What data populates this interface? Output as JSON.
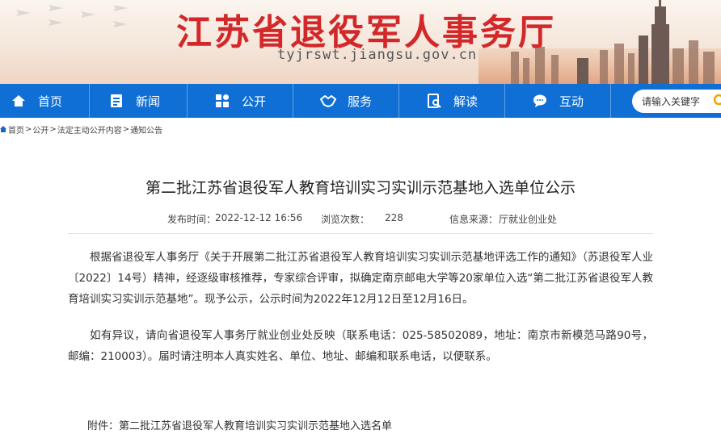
{
  "header": {
    "site_title": "江苏省退役军人事务厅",
    "site_url": "tyjrswt.jiangsu.gov.cn"
  },
  "nav": {
    "items": [
      {
        "label": "首页",
        "icon": "home-icon"
      },
      {
        "label": "新闻",
        "icon": "news-icon"
      },
      {
        "label": "公开",
        "icon": "disclosure-icon"
      },
      {
        "label": "服务",
        "icon": "handshake-icon"
      },
      {
        "label": "解读",
        "icon": "interpretation-icon"
      },
      {
        "label": "互动",
        "icon": "chat-icon"
      }
    ],
    "search_placeholder": "请输入关键字"
  },
  "breadcrumb": {
    "items": [
      "首页",
      "公开",
      "法定主动公开内容",
      "通知公告"
    ],
    "separator": ">"
  },
  "article": {
    "title": "第二批江苏省退役军人教育培训实习实训示范基地入选单位公示",
    "meta": {
      "publish_label": "发布时间：",
      "publish_value": "2022-12-12 16:56",
      "views_label": "浏览次数：",
      "views_value": "228",
      "source_label": "信息来源：",
      "source_value": "厅就业创业处"
    },
    "paragraphs": [
      "根据省退役军人事务厅《关于开展第二批江苏省退役军人教育培训实习实训示范基地评选工作的通知》（苏退役军人业〔2022〕14号）精神，经逐级审核推荐，专家综合评审，拟确定南京邮电大学等20家单位入选“第二批江苏省退役军人教育培训实习实训示范基地”。现予公示，公示时间为2022年12月12日至12月16日。",
      "如有异议，请向省退役军人事务厅就业创业处反映（联系电话：025-58502089，地址：南京市新模范马路90号，邮编：210003）。届时请注明本人真实姓名、单位、地址、邮编和联系电话，以便联系。"
    ],
    "attachment": "附件：第二批江苏省退役军人教育培训实习实训示范基地入选名单"
  },
  "colors": {
    "nav_bg": "#0f6fd5",
    "title_red": "#d3282a",
    "search_icon": "#f5a000"
  }
}
